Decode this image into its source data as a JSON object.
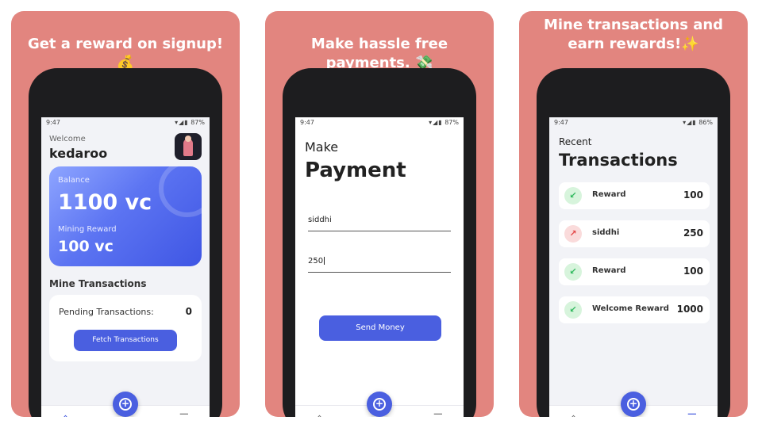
{
  "panels": [
    {
      "headline": "Get a reward on signup! 💰"
    },
    {
      "headline": "Make hassle free payments. 💸"
    },
    {
      "headline": "Mine transactions and earn rewards!✨"
    }
  ],
  "status_bar": {
    "time": "9:47",
    "battery_1": "87%",
    "battery_2": "87%",
    "battery_3": "86%"
  },
  "home": {
    "welcome_label": "Welcome",
    "username": "kedaroo",
    "balance_label": "Balance",
    "balance_value": "1100 vc",
    "mining_label": "Mining Reward",
    "mining_value": "100 vc",
    "mine_title": "Mine Transactions",
    "pending_label": "Pending Transactions:",
    "pending_value": "0",
    "fetch_button": "Fetch Transactions"
  },
  "payment": {
    "heading_small": "Make",
    "heading_large": "Payment",
    "recipient_value": "siddhi",
    "amount_value": "250",
    "send_button": "Send Money"
  },
  "transactions": {
    "heading_small": "Recent",
    "heading_large": "Transactions",
    "items": [
      {
        "name": "Reward",
        "amount": "100",
        "direction": "in"
      },
      {
        "name": "siddhi",
        "amount": "250",
        "direction": "out"
      },
      {
        "name": "Reward",
        "amount": "100",
        "direction": "in"
      },
      {
        "name": "Welcome Reward",
        "amount": "1000",
        "direction": "in"
      }
    ]
  },
  "nav": {
    "home_icon": "home-icon",
    "add_icon": "plus-circle-icon",
    "history_icon": "receipt-icon",
    "accent": "#4a5fe0"
  },
  "colors": {
    "panel_bg": "#E2857F",
    "accent": "#4a5fe0",
    "income": "#2eb85c",
    "expense": "#e34848"
  }
}
